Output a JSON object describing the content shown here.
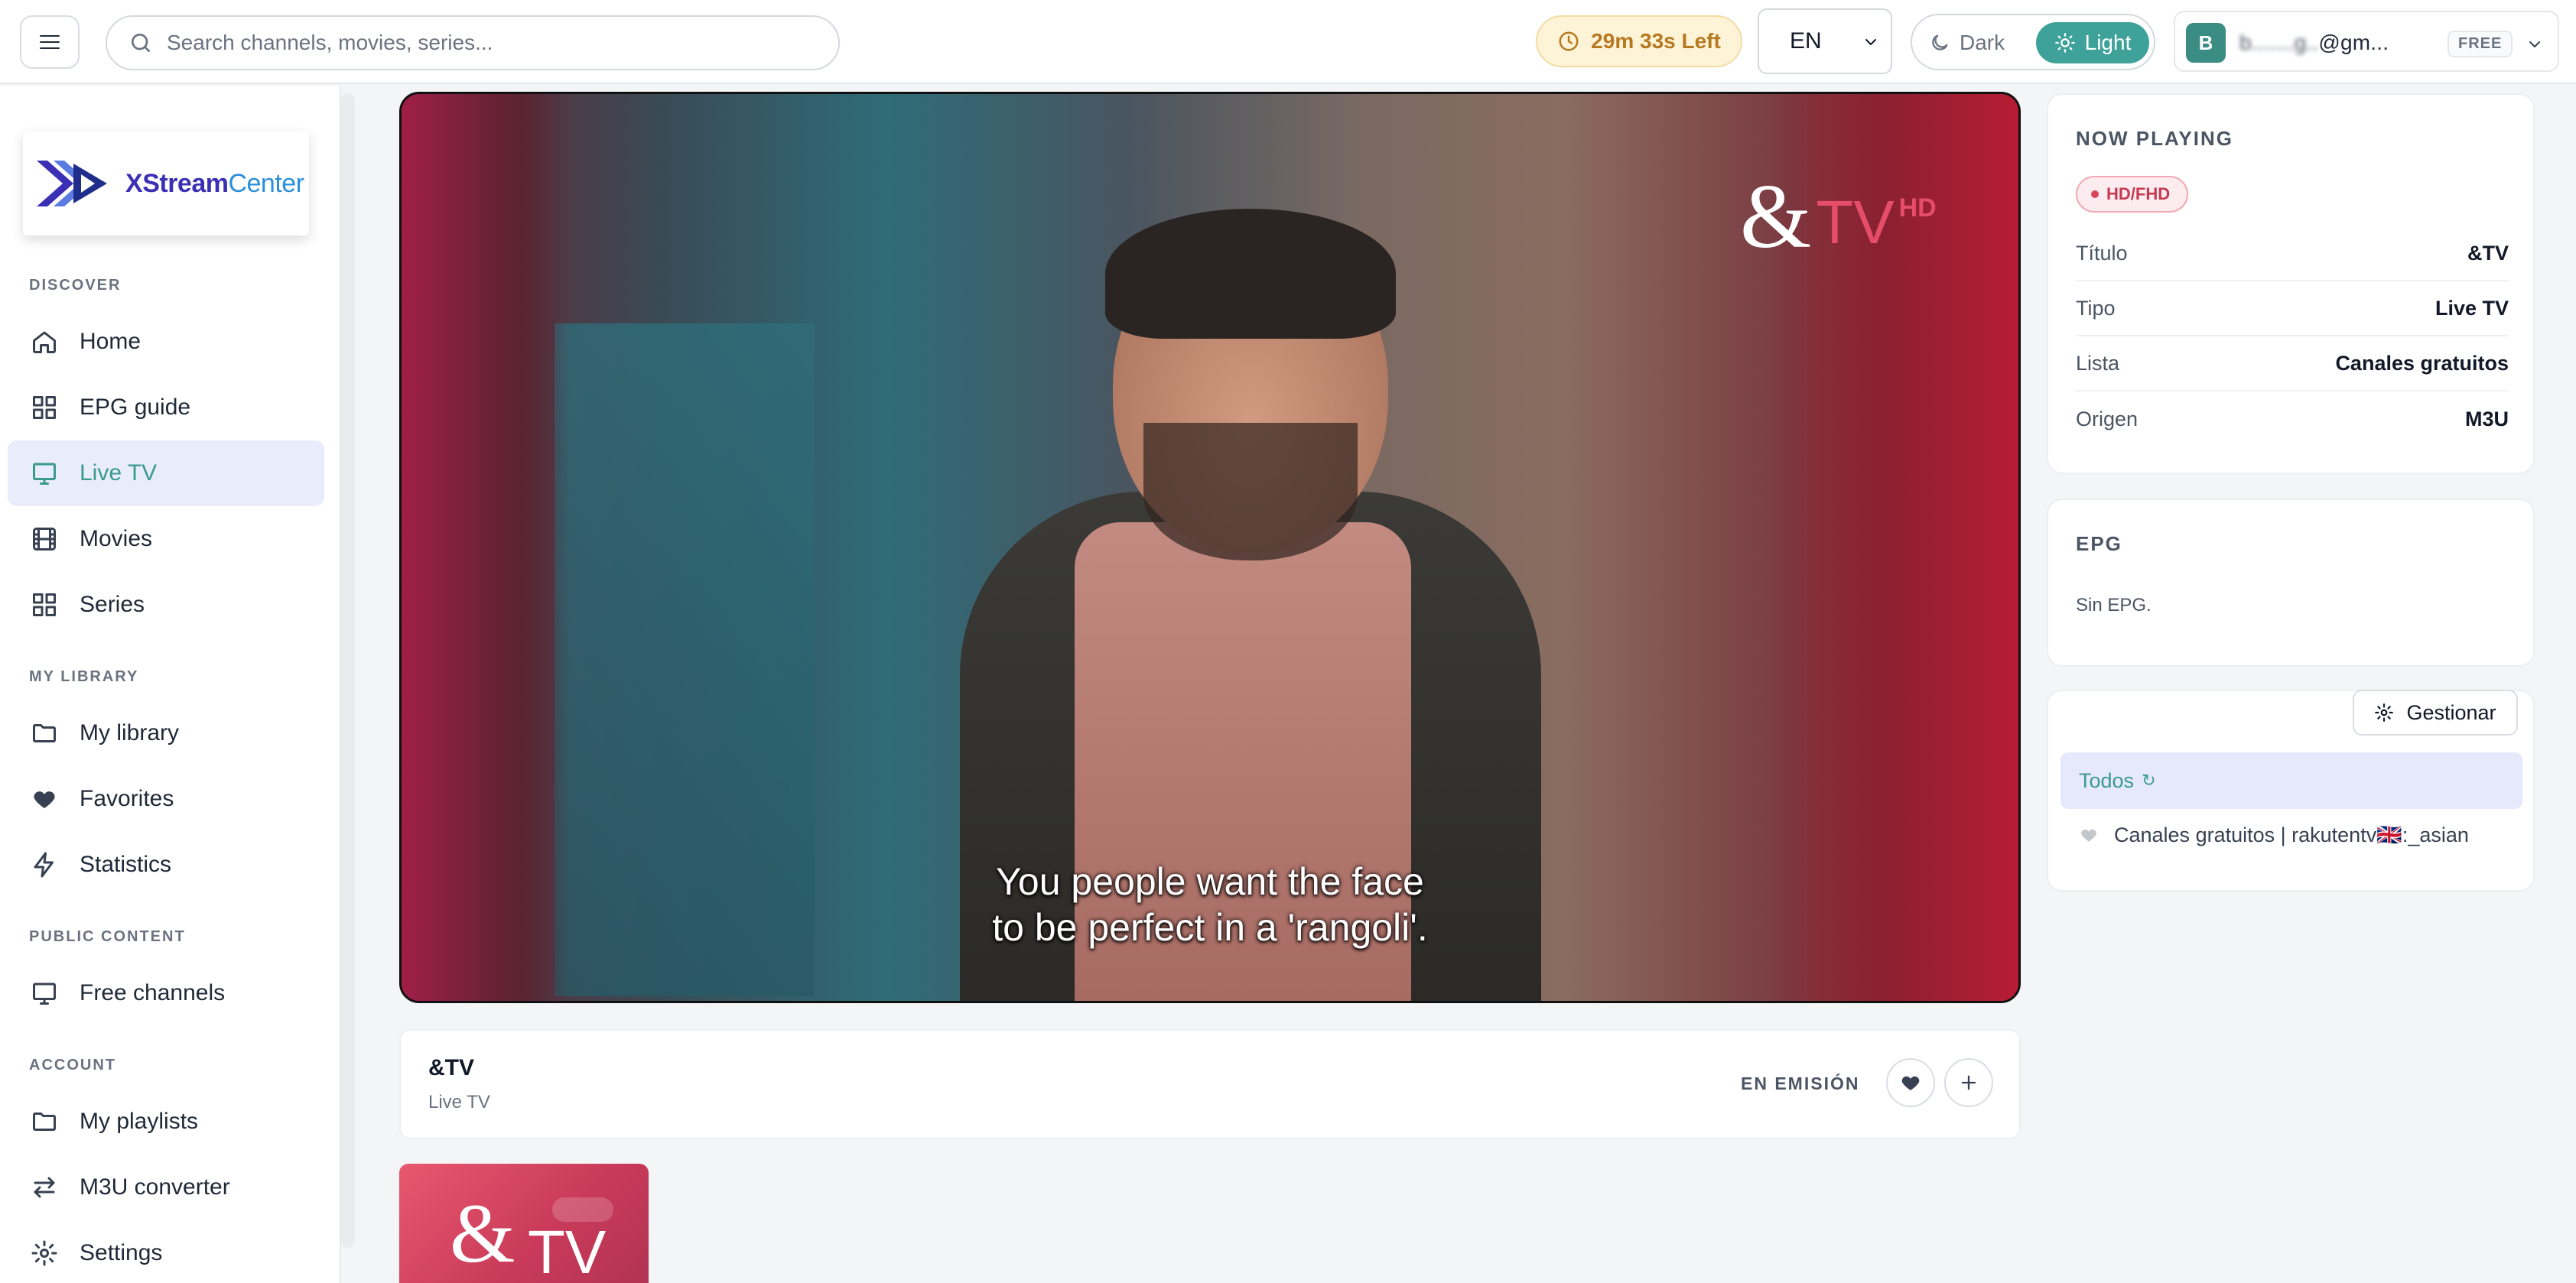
{
  "header": {
    "menu_icon": "hamburger-icon",
    "search_placeholder": "Search channels, movies, series...",
    "timer_label": "29m 33s Left",
    "language": "EN",
    "theme_dark_label": "Dark",
    "theme_light_label": "Light",
    "theme_selected": "Light",
    "user_initial": "B",
    "user_email_masked": "b.......g..",
    "user_email_domain": "@gm...",
    "plan_badge": "FREE"
  },
  "sidebar": {
    "logo_text_x": "X",
    "logo_text_stream": "Stream",
    "logo_text_center": "Center",
    "sections": {
      "discover": "DISCOVER",
      "library": "MY LIBRARY",
      "public": "PUBLIC CONTENT",
      "account": "ACCOUNT"
    },
    "items": {
      "home": "Home",
      "epg": "EPG guide",
      "livetv": "Live TV",
      "movies": "Movies",
      "series": "Series",
      "mylibrary": "My library",
      "favorites": "Favorites",
      "statistics": "Statistics",
      "freechannels": "Free channels",
      "myplaylists": "My playlists",
      "m3u": "M3U converter",
      "settings": "Settings"
    },
    "active_item": "Live TV"
  },
  "player": {
    "channel_logo_amp": "&",
    "channel_logo_tv": "TV",
    "channel_logo_hd": "HD",
    "subtitle_line1": "You people want the face",
    "subtitle_line2": "to be perfect in a 'rangoli'."
  },
  "info": {
    "title": "&TV",
    "type": "Live TV",
    "status": "EN EMISIÓN"
  },
  "thumbnail": {
    "amp": "&",
    "tv": "TV"
  },
  "now_playing": {
    "heading": "NOW PLAYING",
    "badge": "HD/FHD",
    "rows": [
      {
        "key": "Título",
        "value": "&TV"
      },
      {
        "key": "Tipo",
        "value": "Live TV"
      },
      {
        "key": "Lista",
        "value": "Canales gratuitos"
      },
      {
        "key": "Origen",
        "value": "M3U"
      }
    ]
  },
  "epg": {
    "heading": "EPG",
    "text": "Sin EPG."
  },
  "playlists": {
    "manage_label": "Gestionar",
    "all_label": "Todos",
    "item_label": "Canales gratuitos | rakutentv🇬🇧:_asian"
  },
  "colors": {
    "accent": "#3fa29a",
    "active_bg": "#e8ecfb",
    "timer_text": "#b7791f",
    "badge_red": "#c53952"
  }
}
